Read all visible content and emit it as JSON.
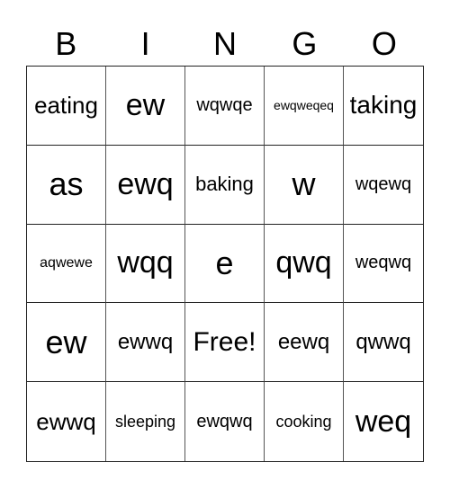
{
  "header": {
    "letters": [
      "B",
      "I",
      "N",
      "G",
      "O"
    ]
  },
  "card": {
    "rows": [
      [
        "eating",
        "ew",
        "wqwqe",
        "ewqweqeq",
        "taking"
      ],
      [
        "as",
        "ewq",
        "baking",
        "w",
        "wqewq"
      ],
      [
        "aqwewe",
        "wqq",
        "e",
        "qwq",
        "weqwq"
      ],
      [
        "ew",
        "ewwq",
        "Free!",
        "eewq",
        "qwwq"
      ],
      [
        "ewwq",
        "sleeping",
        "ewqwq",
        "cooking",
        "weq"
      ]
    ],
    "free_space": "Free!"
  }
}
